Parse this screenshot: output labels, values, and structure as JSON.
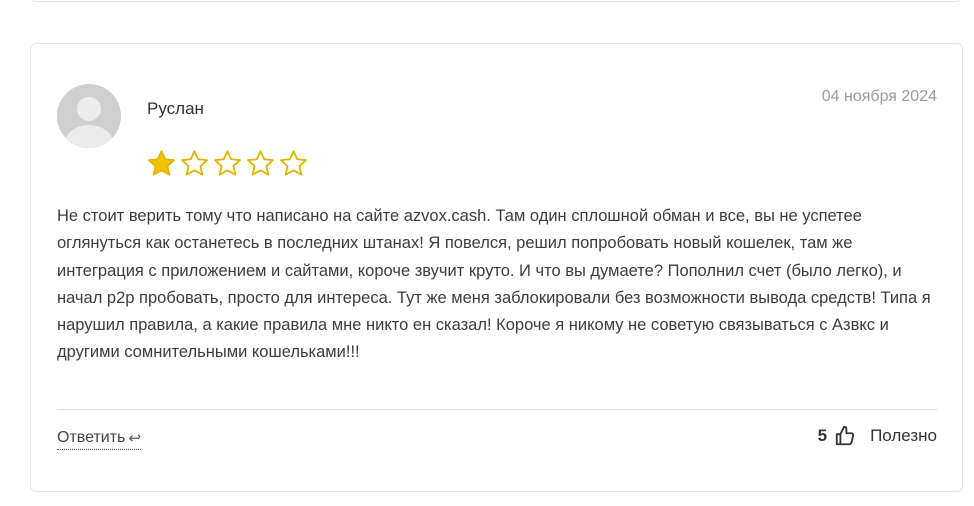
{
  "review": {
    "author": "Руслан",
    "date": "04 ноября 2024",
    "rating": 1,
    "rating_max": 5,
    "text": "Не стоит верить тому что написано на сайте azvox.cash. Там один сплошной обман и все, вы не успетее оглянуться как останетесь в последних штанах! Я повелся, решил попробовать новый кошелек, там же интеграция с приложением и сайтами, короче звучит круто. И что вы думаете? Пополнил счет (было легко), и начал p2p пробовать, просто для интереса. Тут же меня заблокировали без возможности вывода средств! Типа я нарушил правила, а какие правила мне никто ен сказал! Короче я никому не советую связываться с Азвкс и другими сомнительными кошельками!!!",
    "reply_label": "Ответить",
    "reply_icon": "reply-arrow-icon",
    "likes": "5",
    "helpful_label": "Полезно"
  },
  "colors": {
    "star_filled": "#f2c200",
    "star_outline": "#e0b400"
  }
}
